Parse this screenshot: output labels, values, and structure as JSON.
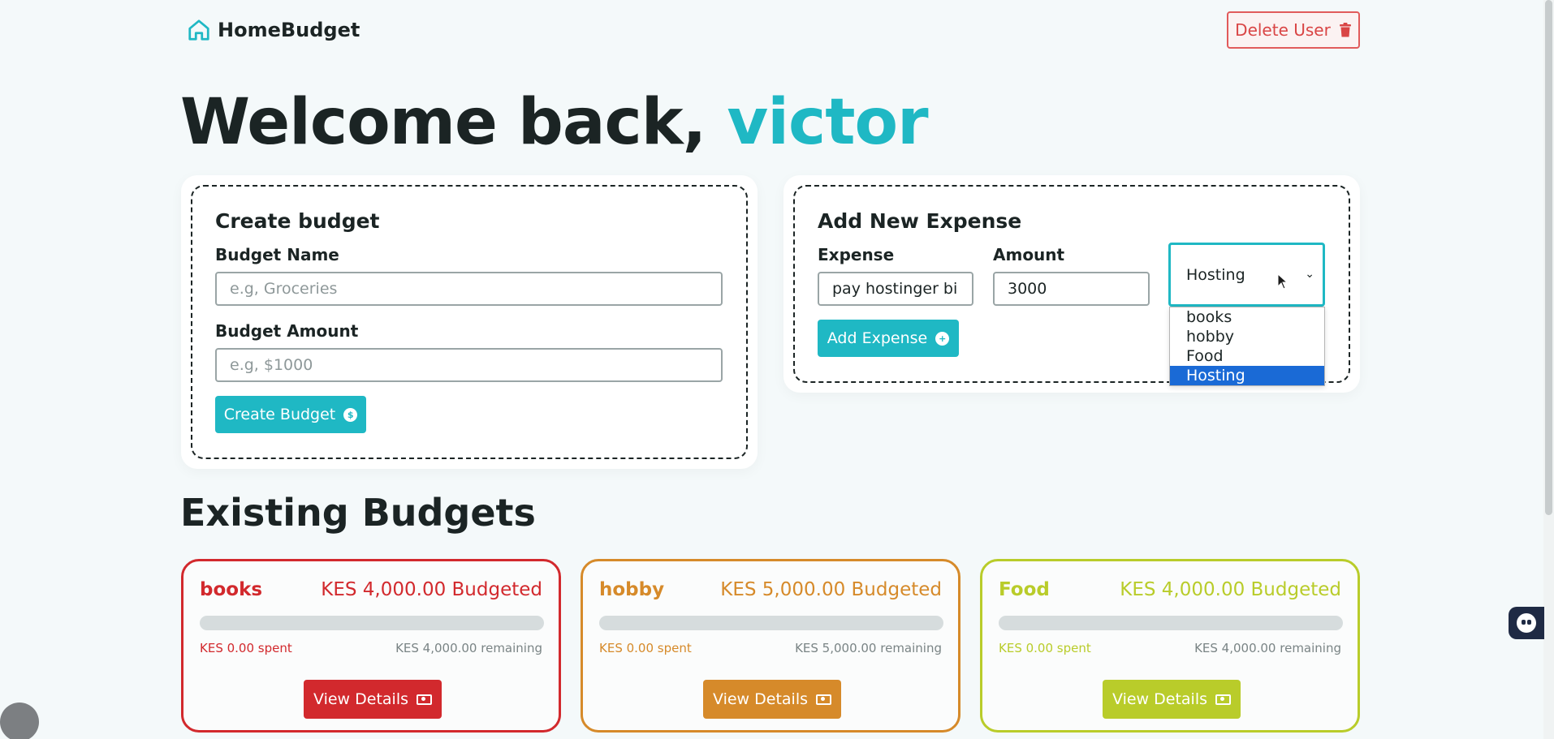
{
  "brand": {
    "name": "HomeBudget",
    "icon": "home-icon"
  },
  "header": {
    "delete_user_label": "Delete User",
    "delete_icon": "trash-icon"
  },
  "welcome": {
    "greeting": "Welcome back, ",
    "username": "victor"
  },
  "create_budget": {
    "title": "Create budget",
    "name_label": "Budget Name",
    "name_placeholder": "e.g, Groceries",
    "amount_label": "Budget Amount",
    "amount_placeholder": "e.g, $1000",
    "button_label": "Create Budget",
    "button_icon": "coin-icon"
  },
  "add_expense": {
    "title": "Add New Expense",
    "expense_label": "Expense",
    "expense_value": "pay hostinger bill",
    "amount_label": "Amount",
    "amount_value": "3000",
    "category_selected": "Hosting",
    "category_options": [
      "books",
      "hobby",
      "Food",
      "Hosting"
    ],
    "button_label": "Add Expense",
    "button_icon": "plus-circle-icon"
  },
  "existing_budgets": {
    "title": "Existing Budgets",
    "items": [
      {
        "name": "books",
        "budgeted": "KES 4,000.00 Budgeted",
        "spent": "KES 0.00 spent",
        "remaining": "KES 4,000.00 remaining",
        "progress": 0,
        "color": "#d2292d",
        "button_label": "View Details"
      },
      {
        "name": "hobby",
        "budgeted": "KES 5,000.00 Budgeted",
        "spent": "KES 0.00 spent",
        "remaining": "KES 5,000.00 remaining",
        "progress": 0,
        "color": "#d68a2a",
        "button_label": "View Details"
      },
      {
        "name": "Food",
        "budgeted": "KES 4,000.00 Budgeted",
        "spent": "KES 0.00 spent",
        "remaining": "KES 4,000.00 remaining",
        "progress": 0,
        "color": "#b9cc2a",
        "button_label": "View Details"
      }
    ]
  }
}
